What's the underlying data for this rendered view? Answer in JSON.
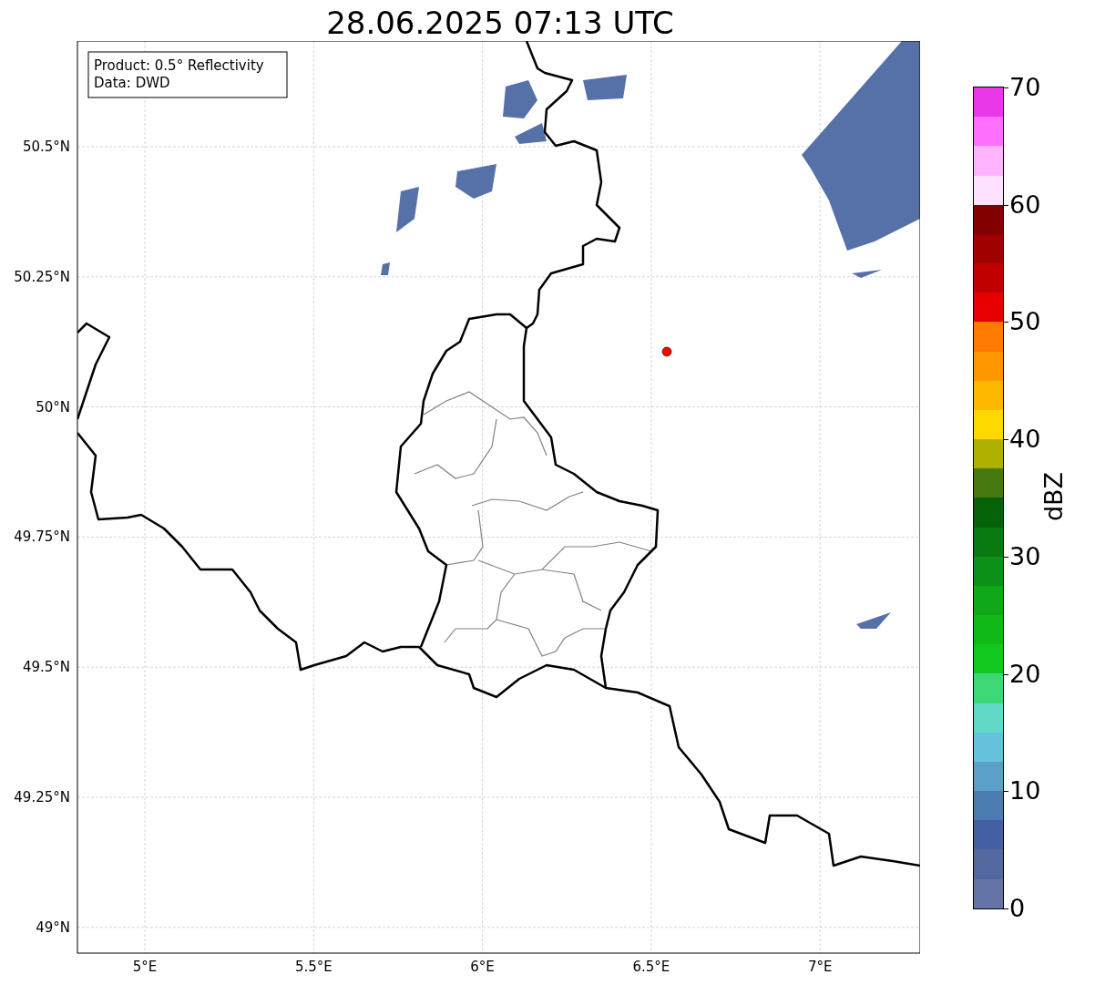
{
  "title": "28.06.2025 07:13 UTC",
  "map": {
    "legend": [
      "Product: 0.5° Reflectivity",
      "Data: DWD"
    ],
    "yticks": [
      "50.5°N",
      "50.25°N",
      "50°N",
      "49.75°N",
      "49.5°N",
      "49.25°N",
      "49°N"
    ],
    "xticks": [
      "5°E",
      "5.5°E",
      "6°E",
      "6.5°E",
      "7°E"
    ]
  },
  "colorbar": {
    "label": "dBZ",
    "ticks": [
      "70",
      "60",
      "50",
      "40",
      "30",
      "20",
      "10",
      "0"
    ],
    "segments": [
      {
        "color": "#e838e8"
      },
      {
        "color": "#ff70ff"
      },
      {
        "color": "#ffb4ff"
      },
      {
        "color": "#ffe0ff"
      },
      {
        "color": "#800000"
      },
      {
        "color": "#a00000"
      },
      {
        "color": "#c00000"
      },
      {
        "color": "#e60000"
      },
      {
        "color": "#ff7a00"
      },
      {
        "color": "#ff9800"
      },
      {
        "color": "#ffb800"
      },
      {
        "color": "#ffd800"
      },
      {
        "color": "#b0b000"
      },
      {
        "color": "#467810"
      },
      {
        "color": "#066208"
      },
      {
        "color": "#097a10"
      },
      {
        "color": "#0c9018"
      },
      {
        "color": "#10a818"
      },
      {
        "color": "#10b818"
      },
      {
        "color": "#12c820"
      },
      {
        "color": "#3ed876"
      },
      {
        "color": "#62d8c6"
      },
      {
        "color": "#66c2dc"
      },
      {
        "color": "#5aa0c8"
      },
      {
        "color": "#4a7cb2"
      },
      {
        "color": "#4460a2"
      },
      {
        "color": "#5468a0"
      },
      {
        "color": "#6574a6"
      }
    ]
  }
}
